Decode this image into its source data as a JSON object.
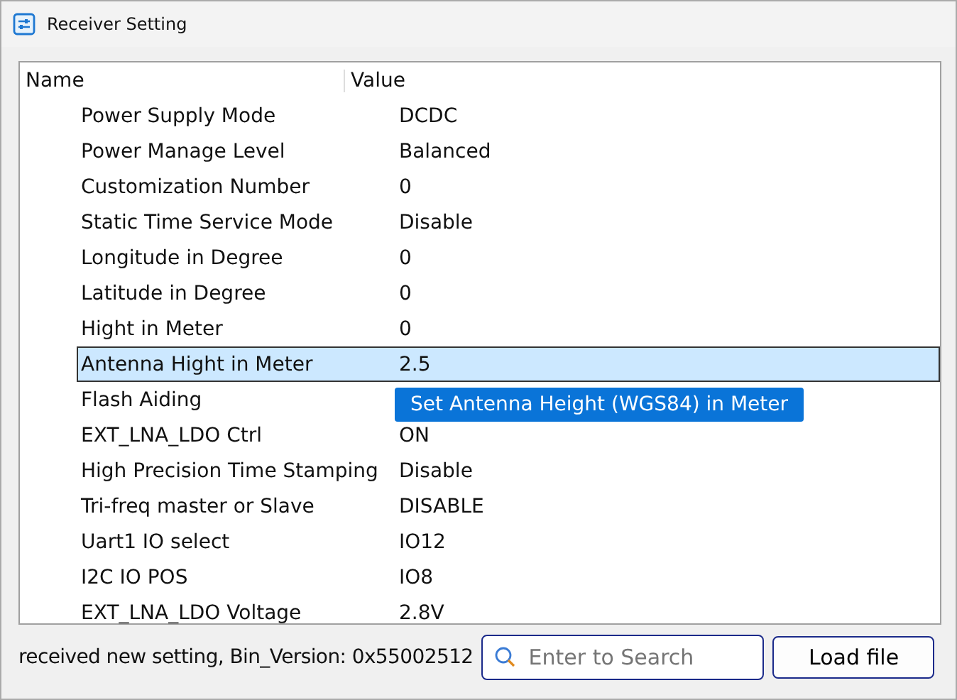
{
  "window": {
    "title": "Receiver Setting"
  },
  "table": {
    "columns": [
      "Name",
      "Value"
    ],
    "rows": [
      {
        "name": "Power Supply Mode",
        "value": "DCDC",
        "selected": false
      },
      {
        "name": "Power Manage Level",
        "value": "Balanced",
        "selected": false
      },
      {
        "name": "Customization Number",
        "value": "0",
        "selected": false
      },
      {
        "name": "Static Time Service Mode",
        "value": "Disable",
        "selected": false
      },
      {
        "name": "Longitude in Degree",
        "value": "0",
        "selected": false
      },
      {
        "name": "Latitude in Degree",
        "value": "0",
        "selected": false
      },
      {
        "name": "Hight in Meter",
        "value": "0",
        "selected": false
      },
      {
        "name": "Antenna Hight in Meter",
        "value": "2.5",
        "selected": true
      },
      {
        "name": "Flash Aiding",
        "selected": false
      },
      {
        "name": "EXT_LNA_LDO Ctrl",
        "value": "ON",
        "selected": false
      },
      {
        "name": "High Precision Time Stamping",
        "value": "Disable",
        "selected": false
      },
      {
        "name": "Tri-freq master or Slave",
        "value": "DISABLE",
        "selected": false
      },
      {
        "name": "Uart1 IO select",
        "value": "IO12",
        "selected": false
      },
      {
        "name": "I2C IO POS",
        "value": "IO8",
        "selected": false
      },
      {
        "name": "EXT_LNA_LDO Voltage",
        "value": "2.8V",
        "selected": false
      }
    ],
    "tooltip": "Set Antenna Height (WGS84) in Meter"
  },
  "status_bar": {
    "message": "received new setting,  Bin_Version: 0x55002512",
    "search": {
      "placeholder": "Enter to Search"
    },
    "button": "Load file"
  }
}
